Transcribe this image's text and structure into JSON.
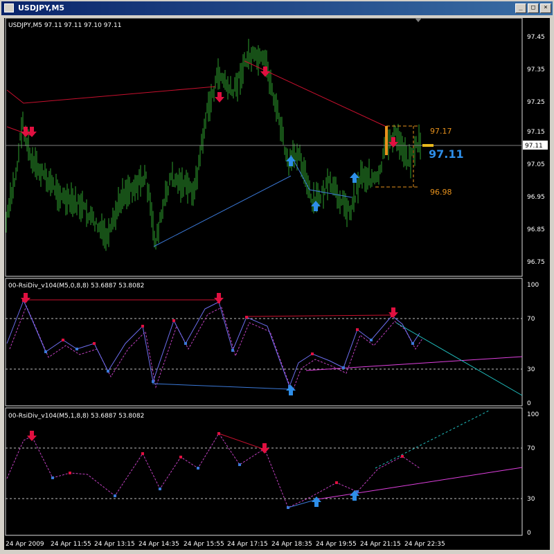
{
  "window": {
    "title": "USDJPY,M5",
    "minimize_glyph": "_",
    "maximize_glyph": "□",
    "close_glyph": "×"
  },
  "colors": {
    "background": "#000000",
    "candles": "#2ea02e",
    "grid_dashed": "#c0c0c0",
    "price_line_red": "#c8102e",
    "blue_line": "#3b79d8",
    "magenta_line": "#e040e0",
    "cyan_line": "#20c0c0",
    "orange": "#e8921c",
    "arrow_down": "#e01040",
    "arrow_up": "#2e8ee8"
  },
  "main_panel": {
    "header": "USDJPY,M5  97.11 97.11 97.10 97.11",
    "price_labels": [
      "97.45",
      "97.35",
      "97.25",
      "97.15",
      "97.05",
      "96.95",
      "96.85",
      "96.75"
    ],
    "current_price_box": "97.11",
    "big_price_label": "97.11",
    "upper_level_label": "97.17",
    "lower_level_label": "96.98"
  },
  "rsi_panel_1": {
    "header": "00-RsiDiv_v104(M5,0,8,8) 53.6887 53.8082",
    "scale": [
      "100",
      "70",
      "30",
      "0"
    ]
  },
  "rsi_panel_2": {
    "header": "00-RsiDiv_v104(M5,1,8,8) 53.6887 53.8082",
    "scale": [
      "100",
      "70",
      "30",
      "0"
    ]
  },
  "time_axis": [
    "24 Apr 2009",
    "24 Apr 11:55",
    "24 Apr 13:15",
    "24 Apr 14:35",
    "24 Apr 15:55",
    "24 Apr 17:15",
    "24 Apr 18:35",
    "24 Apr 19:55",
    "24 Apr 21:15",
    "24 Apr 22:35"
  ]
}
